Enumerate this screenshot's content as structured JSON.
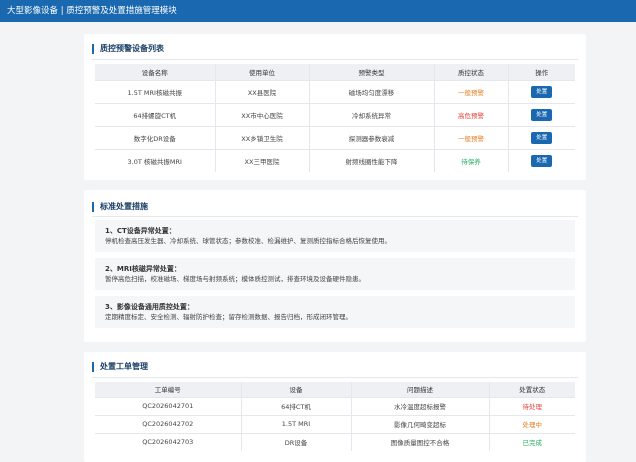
{
  "app_title": "大型影像设备 | 质控预警及处置措施管理模块",
  "warning_list": {
    "title": "质控预警设备列表",
    "columns": [
      "设备名称",
      "使用单位",
      "预警类型",
      "质控状态",
      "操作"
    ],
    "rows": [
      {
        "name": "1.5T MRI核磁共振",
        "unit": "XX县医院",
        "type": "磁场均匀度漂移",
        "status": "一般预警",
        "status_color": "orange",
        "action": "处置"
      },
      {
        "name": "64排螺旋CT机",
        "unit": "XX市中心医院",
        "type": "冷却系统异常",
        "status": "高危预警",
        "status_color": "red",
        "action": "处置"
      },
      {
        "name": "数字化DR设备",
        "unit": "XX乡镇卫生院",
        "type": "探测器参数衰减",
        "status": "一般预警",
        "status_color": "orange",
        "action": "处置"
      },
      {
        "name": "3.0T 核磁共振MRI",
        "unit": "XX三甲医院",
        "type": "射频线圈性能下降",
        "status": "待保养",
        "status_color": "green",
        "action": "处置"
      }
    ]
  },
  "measures": {
    "title": "标准处置措施",
    "items": [
      {
        "title": "1、CT设备异常处置：",
        "text": "停机检查高压发生器、冷却系统、球管状态；参数校准、检漏维护、复测质控指标合格后恢复使用。"
      },
      {
        "title": "2、MRI核磁异常处置：",
        "text": "暂停高危扫描，校准磁场、梯度场与射频系统；模体质控测试，排查环境及设备硬件隐患。"
      },
      {
        "title": "3、影像设备通用质控处置：",
        "text": "定期精度标定、安全检测、辐射防护检查；留存检测数据、报告归档，形成闭环管理。"
      }
    ]
  },
  "work_orders": {
    "title": "处置工单管理",
    "columns": [
      "工单编号",
      "设备",
      "问题描述",
      "处置状态"
    ],
    "rows": [
      {
        "id": "QC2026042701",
        "device": "64排CT机",
        "issue": "水冷温度超标报警",
        "status": "待处理",
        "status_color": "red"
      },
      {
        "id": "QC2026042702",
        "device": "1.5T MRI",
        "issue": "影像几何畸变超标",
        "status": "处理中",
        "status_color": "orange"
      },
      {
        "id": "QC2026042703",
        "device": "DR设备",
        "issue": "图像质量图控不合格",
        "status": "已完成",
        "status_color": "green"
      }
    ]
  },
  "colors": {
    "primary": "#1a69b0",
    "orange": "#e67e22",
    "red": "#e0443a",
    "green": "#27ae60"
  }
}
